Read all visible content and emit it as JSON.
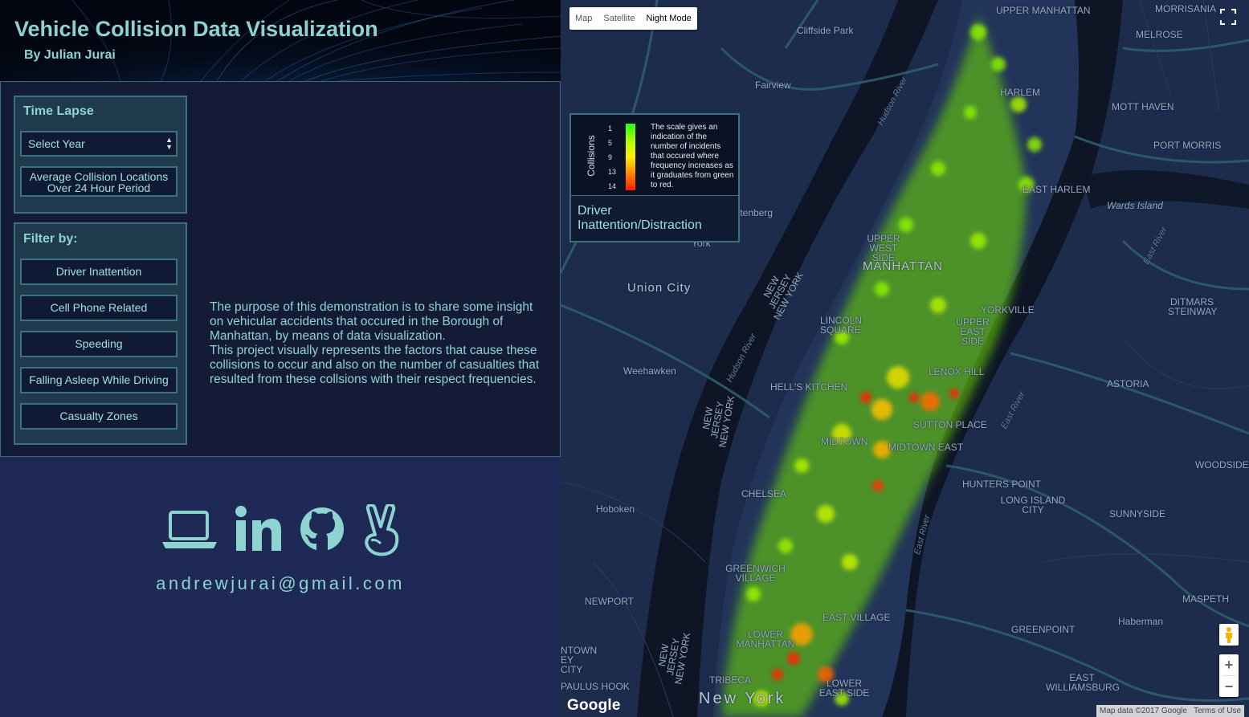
{
  "header": {
    "title": "Vehicle Collision Data Visualization",
    "author": "By Julian Jurai"
  },
  "time_lapse": {
    "title": "Time Lapse",
    "select_value": "Select Year",
    "average_button": "Average Collision Locations Over 24 Hour Period"
  },
  "filter": {
    "title": "Filter by:",
    "buttons": [
      "Driver Inattention",
      "Cell Phone Related",
      "Speeding",
      "Falling Asleep While Driving",
      "Casualty Zones"
    ]
  },
  "description": {
    "p1": "The purpose of this demonstration is to share some insight on vehicular accidents that occured in the Borough of Manhattan, by means of data visualization.",
    "p2": "This project visually represents the factors that cause these collisions to occur and also on the number of casualties that resulted from these collsions with their respect frequencies."
  },
  "social": {
    "icons": [
      "laptop-icon",
      "linkedin-icon",
      "github-icon",
      "angellist-icon"
    ],
    "email": "andrewjurai@gmail.com",
    "color": "#8ed3d0"
  },
  "map": {
    "types": [
      "Map",
      "Satellite",
      "Night Mode"
    ],
    "active_type": "Night Mode",
    "legend": {
      "axis_label": "Collisions",
      "ticks": [
        "1",
        "5",
        "9",
        "13",
        "14"
      ],
      "text": "The scale gives an indication of the number of incidents that occured where frequency increases as it graduates from green to red.",
      "factor": "Driver Inattention/Distraction",
      "gradient_colors": [
        "#22ff22",
        "#aaff00",
        "#ffee00",
        "#ff8800",
        "#ff1a00"
      ]
    },
    "labels": {
      "upper_manhattan": "UPPER MANHATTAN",
      "morrisania": "MORRISANIA",
      "melrose": "MELROSE",
      "cliffside_park": "Cliffside Park",
      "fairview": "Fairview",
      "harlem": "HARLEM",
      "mott_haven": "MOTT HAVEN",
      "port_morris": "PORT MORRIS",
      "east_harlem": "EAST HARLEM",
      "wards_island": "Wards Island",
      "hudson_river_1": "Hudson River",
      "hudson_river_2": "Hudson River",
      "east_river_1": "East River",
      "east_river_2": "East River",
      "east_river_3": "East River",
      "guttenberg": "ttenberg",
      "west_new_york": "York",
      "upper_west_side": "UPPER WEST SIDE",
      "manhattan": "MANHATTAN",
      "union_city": "Union City",
      "nj_ny_1": "NEW JERSEY NEW YORK",
      "nj_ny_2": "NEW JERSEY NEW YORK",
      "nj_ny_3": "NEW JERSEY NEW YORK",
      "lincoln_square": "LINCOLN SQUARE",
      "yorkville": "YORKVILLE",
      "upper_east_side": "UPPER EAST SIDE",
      "ditmars": "DITMARS STEINWAY",
      "weehawken": "Weehawken",
      "lenox_hill": "LENOX HILL",
      "hells_kitchen": "HELL'S KITCHEN",
      "astoria": "ASTORIA",
      "sutton_place": "SUTTON PLACE",
      "midtown": "MIDTOWN",
      "midtown_east": "MIDTOWN EAST",
      "woodside": "WOODSIDE",
      "hunters_point": "HUNTERS POINT",
      "chelsea": "CHELSEA",
      "long_island_city": "LONG ISLAND CITY",
      "hoboken": "Hoboken",
      "sunnyside": "SUNNYSIDE",
      "greenwich_village": "GREENWICH VILLAGE",
      "newport": "NEWPORT",
      "maspeth": "MASPETH",
      "east_village": "EAST VILLAGE",
      "haberman": "Haberman",
      "lower_manhattan": "LOWER MANHATTAN",
      "greenpoint": "GREENPOINT",
      "downtown_jersey_city": "NTOWN EY CITY",
      "tribeca": "TRIBECA",
      "lower_east_side": "LOWER EAST SIDE",
      "east_williamsburg": "EAST WILLIAMSBURG",
      "paulus_hook": "PAULUS HOOK",
      "new_york": "New York"
    },
    "google": "Google",
    "map_data": "Map data ©2017 Google",
    "terms": "Terms of Use"
  }
}
